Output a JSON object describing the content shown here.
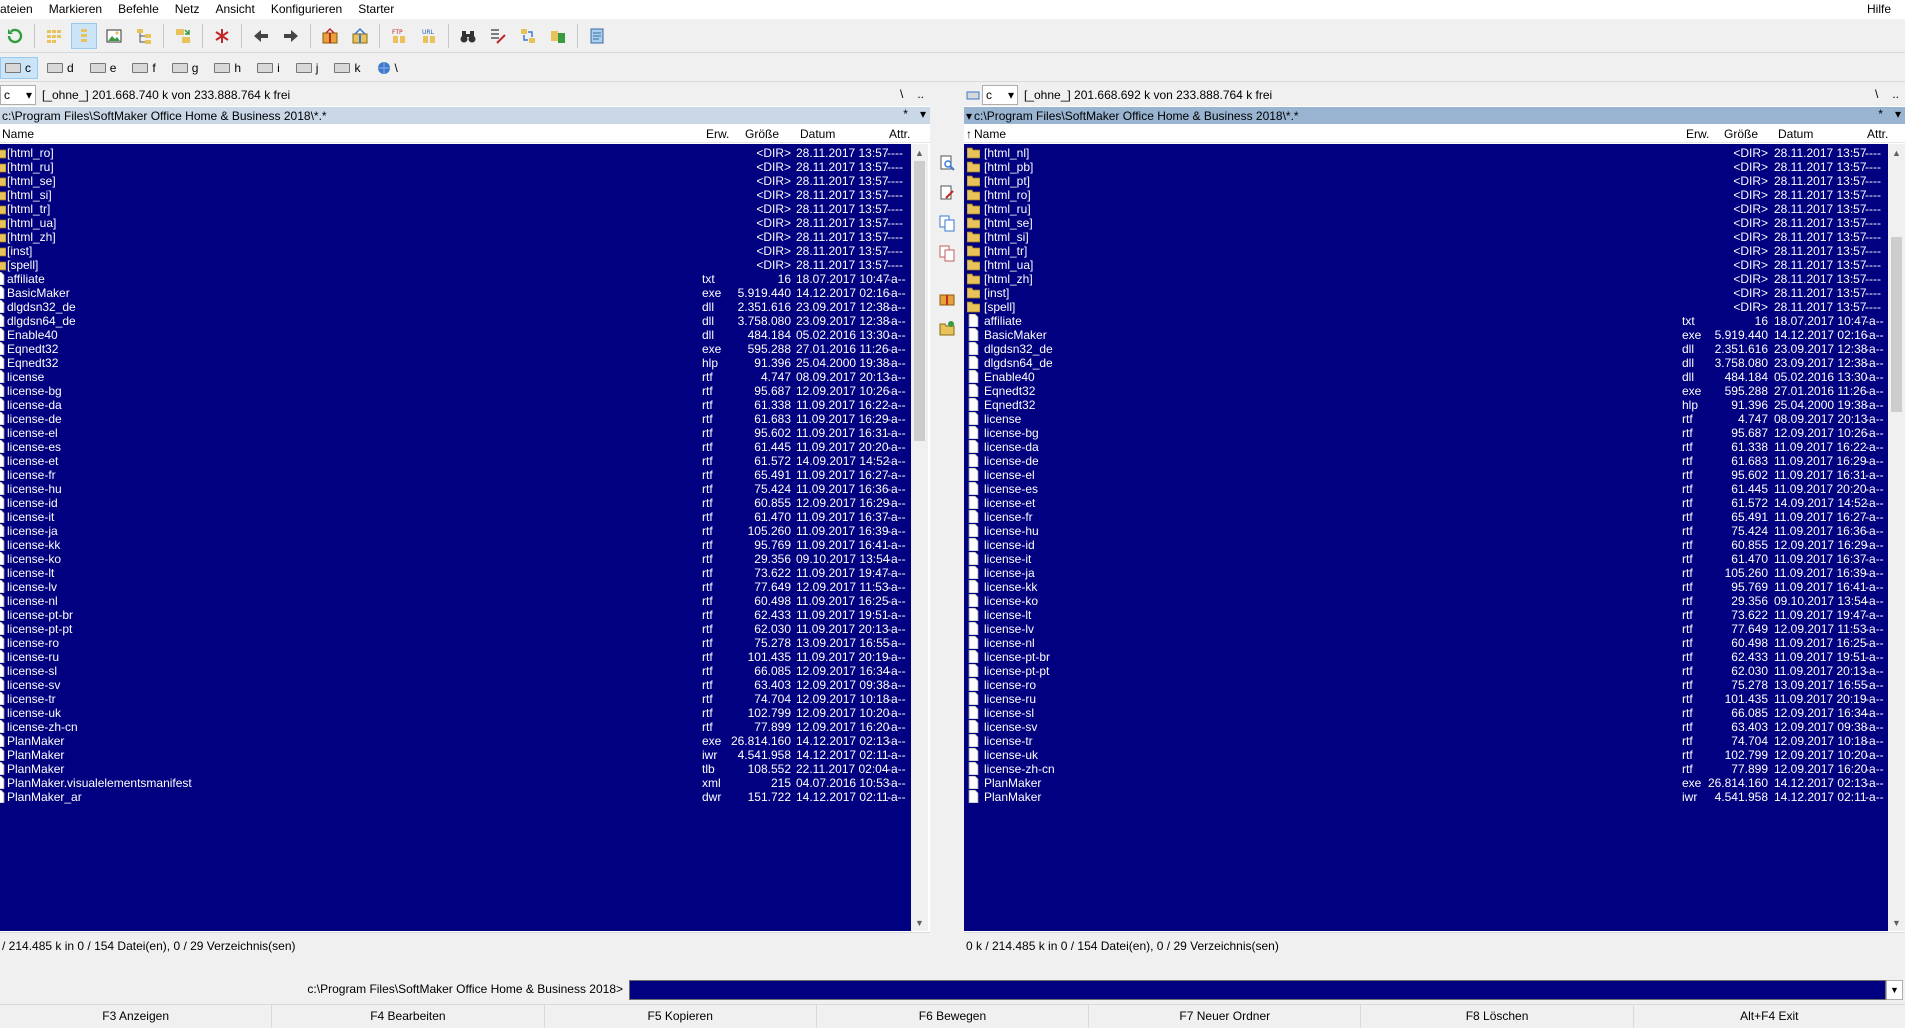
{
  "menu": [
    "ateien",
    "Markieren",
    "Befehle",
    "Netz",
    "Ansicht",
    "Konfigurieren",
    "Starter"
  ],
  "help": "Hilfe",
  "drives": [
    "c",
    "d",
    "e",
    "f",
    "g",
    "h",
    "i",
    "j",
    "k",
    "\\"
  ],
  "left": {
    "drive_select": "c",
    "free_info": "[_ohne_]  201.668.740 k von 233.888.764 k frei",
    "root_btn": "\\",
    "up_btn": "..",
    "path": "c:\\Program Files\\SoftMaker Office Home & Business 2018\\*.*",
    "star_btn": "*",
    "columns": {
      "name": "Name",
      "ext": "Erw.",
      "size": "Größe",
      "date": "Datum",
      "attr": "Attr."
    },
    "files": [
      [
        "[html_ro]",
        "",
        "<DIR>",
        "28.11.2017 13:57",
        "----"
      ],
      [
        "[html_ru]",
        "",
        "<DIR>",
        "28.11.2017 13:57",
        "----"
      ],
      [
        "[html_se]",
        "",
        "<DIR>",
        "28.11.2017 13:57",
        "----"
      ],
      [
        "[html_si]",
        "",
        "<DIR>",
        "28.11.2017 13:57",
        "----"
      ],
      [
        "[html_tr]",
        "",
        "<DIR>",
        "28.11.2017 13:57",
        "----"
      ],
      [
        "[html_ua]",
        "",
        "<DIR>",
        "28.11.2017 13:57",
        "----"
      ],
      [
        "[html_zh]",
        "",
        "<DIR>",
        "28.11.2017 13:57",
        "----"
      ],
      [
        "[inst]",
        "",
        "<DIR>",
        "28.11.2017 13:57",
        "----"
      ],
      [
        "[spell]",
        "",
        "<DIR>",
        "28.11.2017 13:57",
        "----"
      ],
      [
        "affiliate",
        "txt",
        "16",
        "18.07.2017 10:47",
        "-a--"
      ],
      [
        "BasicMaker",
        "exe",
        "5.919.440",
        "14.12.2017 02:16",
        "-a--"
      ],
      [
        "dlgdsn32_de",
        "dll",
        "2.351.616",
        "23.09.2017 12:38",
        "-a--"
      ],
      [
        "dlgdsn64_de",
        "dll",
        "3.758.080",
        "23.09.2017 12:38",
        "-a--"
      ],
      [
        "Enable40",
        "dll",
        "484.184",
        "05.02.2016 13:30",
        "-a--"
      ],
      [
        "Eqnedt32",
        "exe",
        "595.288",
        "27.01.2016 11:26",
        "-a--"
      ],
      [
        "Eqnedt32",
        "hlp",
        "91.396",
        "25.04.2000 19:38",
        "-a--"
      ],
      [
        "license",
        "rtf",
        "4.747",
        "08.09.2017 20:13",
        "-a--"
      ],
      [
        "license-bg",
        "rtf",
        "95.687",
        "12.09.2017 10:26",
        "-a--"
      ],
      [
        "license-da",
        "rtf",
        "61.338",
        "11.09.2017 16:22",
        "-a--"
      ],
      [
        "license-de",
        "rtf",
        "61.683",
        "11.09.2017 16:29",
        "-a--"
      ],
      [
        "license-el",
        "rtf",
        "95.602",
        "11.09.2017 16:31",
        "-a--"
      ],
      [
        "license-es",
        "rtf",
        "61.445",
        "11.09.2017 20:20",
        "-a--"
      ],
      [
        "license-et",
        "rtf",
        "61.572",
        "14.09.2017 14:52",
        "-a--"
      ],
      [
        "license-fr",
        "rtf",
        "65.491",
        "11.09.2017 16:27",
        "-a--"
      ],
      [
        "license-hu",
        "rtf",
        "75.424",
        "11.09.2017 16:36",
        "-a--"
      ],
      [
        "license-id",
        "rtf",
        "60.855",
        "12.09.2017 16:29",
        "-a--"
      ],
      [
        "license-it",
        "rtf",
        "61.470",
        "11.09.2017 16:37",
        "-a--"
      ],
      [
        "license-ja",
        "rtf",
        "105.260",
        "11.09.2017 16:39",
        "-a--"
      ],
      [
        "license-kk",
        "rtf",
        "95.769",
        "11.09.2017 16:41",
        "-a--"
      ],
      [
        "license-ko",
        "rtf",
        "29.356",
        "09.10.2017 13:54",
        "-a--"
      ],
      [
        "license-lt",
        "rtf",
        "73.622",
        "11.09.2017 19:47",
        "-a--"
      ],
      [
        "license-lv",
        "rtf",
        "77.649",
        "12.09.2017 11:53",
        "-a--"
      ],
      [
        "license-nl",
        "rtf",
        "60.498",
        "11.09.2017 16:25",
        "-a--"
      ],
      [
        "license-pt-br",
        "rtf",
        "62.433",
        "11.09.2017 19:51",
        "-a--"
      ],
      [
        "license-pt-pt",
        "rtf",
        "62.030",
        "11.09.2017 20:13",
        "-a--"
      ],
      [
        "license-ro",
        "rtf",
        "75.278",
        "13.09.2017 16:55",
        "-a--"
      ],
      [
        "license-ru",
        "rtf",
        "101.435",
        "11.09.2017 20:19",
        "-a--"
      ],
      [
        "license-sl",
        "rtf",
        "66.085",
        "12.09.2017 16:34",
        "-a--"
      ],
      [
        "license-sv",
        "rtf",
        "63.403",
        "12.09.2017 09:38",
        "-a--"
      ],
      [
        "license-tr",
        "rtf",
        "74.704",
        "12.09.2017 10:18",
        "-a--"
      ],
      [
        "license-uk",
        "rtf",
        "102.799",
        "12.09.2017 10:20",
        "-a--"
      ],
      [
        "license-zh-cn",
        "rtf",
        "77.899",
        "12.09.2017 16:20",
        "-a--"
      ],
      [
        "PlanMaker",
        "exe",
        "26.814.160",
        "14.12.2017 02:13",
        "-a--"
      ],
      [
        "PlanMaker",
        "iwr",
        "4.541.958",
        "14.12.2017 02:11",
        "-a--"
      ],
      [
        "PlanMaker",
        "tlb",
        "108.552",
        "22.11.2017 02:04",
        "-a--"
      ],
      [
        "PlanMaker.visualelementsmanifest",
        "xml",
        "215",
        "04.07.2016 10:53",
        "-a--"
      ],
      [
        "PlanMaker_ar",
        "dwr",
        "151.722",
        "14.12.2017 02:11",
        "-a--"
      ]
    ],
    "status": "/ 214.485 k in 0 / 154 Datei(en), 0 / 29 Verzeichnis(sen)"
  },
  "right": {
    "drive_select": "c",
    "free_info": "[_ohne_]  201.668.692 k von 233.888.764 k frei",
    "root_btn": "\\",
    "up_btn": "..",
    "path": "c:\\Program Files\\SoftMaker Office Home & Business 2018\\*.*",
    "star_btn": "*",
    "columns": {
      "name": "Name",
      "ext": "Erw.",
      "size": "Größe",
      "date": "Datum",
      "attr": "Attr."
    },
    "files": [
      [
        "[html_nl]",
        "",
        "<DIR>",
        "28.11.2017 13:57",
        "----"
      ],
      [
        "[html_pb]",
        "",
        "<DIR>",
        "28.11.2017 13:57",
        "----"
      ],
      [
        "[html_pt]",
        "",
        "<DIR>",
        "28.11.2017 13:57",
        "----"
      ],
      [
        "[html_ro]",
        "",
        "<DIR>",
        "28.11.2017 13:57",
        "----"
      ],
      [
        "[html_ru]",
        "",
        "<DIR>",
        "28.11.2017 13:57",
        "----"
      ],
      [
        "[html_se]",
        "",
        "<DIR>",
        "28.11.2017 13:57",
        "----"
      ],
      [
        "[html_si]",
        "",
        "<DIR>",
        "28.11.2017 13:57",
        "----"
      ],
      [
        "[html_tr]",
        "",
        "<DIR>",
        "28.11.2017 13:57",
        "----"
      ],
      [
        "[html_ua]",
        "",
        "<DIR>",
        "28.11.2017 13:57",
        "----"
      ],
      [
        "[html_zh]",
        "",
        "<DIR>",
        "28.11.2017 13:57",
        "----"
      ],
      [
        "[inst]",
        "",
        "<DIR>",
        "28.11.2017 13:57",
        "----"
      ],
      [
        "[spell]",
        "",
        "<DIR>",
        "28.11.2017 13:57",
        "----"
      ],
      [
        "affiliate",
        "txt",
        "16",
        "18.07.2017 10:47",
        "-a--"
      ],
      [
        "BasicMaker",
        "exe",
        "5.919.440",
        "14.12.2017 02:16",
        "-a--"
      ],
      [
        "dlgdsn32_de",
        "dll",
        "2.351.616",
        "23.09.2017 12:38",
        "-a--"
      ],
      [
        "dlgdsn64_de",
        "dll",
        "3.758.080",
        "23.09.2017 12:38",
        "-a--"
      ],
      [
        "Enable40",
        "dll",
        "484.184",
        "05.02.2016 13:30",
        "-a--"
      ],
      [
        "Eqnedt32",
        "exe",
        "595.288",
        "27.01.2016 11:26",
        "-a--"
      ],
      [
        "Eqnedt32",
        "hlp",
        "91.396",
        "25.04.2000 19:38",
        "-a--"
      ],
      [
        "license",
        "rtf",
        "4.747",
        "08.09.2017 20:13",
        "-a--"
      ],
      [
        "license-bg",
        "rtf",
        "95.687",
        "12.09.2017 10:26",
        "-a--"
      ],
      [
        "license-da",
        "rtf",
        "61.338",
        "11.09.2017 16:22",
        "-a--"
      ],
      [
        "license-de",
        "rtf",
        "61.683",
        "11.09.2017 16:29",
        "-a--"
      ],
      [
        "license-el",
        "rtf",
        "95.602",
        "11.09.2017 16:31",
        "-a--"
      ],
      [
        "license-es",
        "rtf",
        "61.445",
        "11.09.2017 20:20",
        "-a--"
      ],
      [
        "license-et",
        "rtf",
        "61.572",
        "14.09.2017 14:52",
        "-a--"
      ],
      [
        "license-fr",
        "rtf",
        "65.491",
        "11.09.2017 16:27",
        "-a--"
      ],
      [
        "license-hu",
        "rtf",
        "75.424",
        "11.09.2017 16:36",
        "-a--"
      ],
      [
        "license-id",
        "rtf",
        "60.855",
        "12.09.2017 16:29",
        "-a--"
      ],
      [
        "license-it",
        "rtf",
        "61.470",
        "11.09.2017 16:37",
        "-a--"
      ],
      [
        "license-ja",
        "rtf",
        "105.260",
        "11.09.2017 16:39",
        "-a--"
      ],
      [
        "license-kk",
        "rtf",
        "95.769",
        "11.09.2017 16:41",
        "-a--"
      ],
      [
        "license-ko",
        "rtf",
        "29.356",
        "09.10.2017 13:54",
        "-a--"
      ],
      [
        "license-lt",
        "rtf",
        "73.622",
        "11.09.2017 19:47",
        "-a--"
      ],
      [
        "license-lv",
        "rtf",
        "77.649",
        "12.09.2017 11:53",
        "-a--"
      ],
      [
        "license-nl",
        "rtf",
        "60.498",
        "11.09.2017 16:25",
        "-a--"
      ],
      [
        "license-pt-br",
        "rtf",
        "62.433",
        "11.09.2017 19:51",
        "-a--"
      ],
      [
        "license-pt-pt",
        "rtf",
        "62.030",
        "11.09.2017 20:13",
        "-a--"
      ],
      [
        "license-ro",
        "rtf",
        "75.278",
        "13.09.2017 16:55",
        "-a--"
      ],
      [
        "license-ru",
        "rtf",
        "101.435",
        "11.09.2017 20:19",
        "-a--"
      ],
      [
        "license-sl",
        "rtf",
        "66.085",
        "12.09.2017 16:34",
        "-a--"
      ],
      [
        "license-sv",
        "rtf",
        "63.403",
        "12.09.2017 09:38",
        "-a--"
      ],
      [
        "license-tr",
        "rtf",
        "74.704",
        "12.09.2017 10:18",
        "-a--"
      ],
      [
        "license-uk",
        "rtf",
        "102.799",
        "12.09.2017 10:20",
        "-a--"
      ],
      [
        "license-zh-cn",
        "rtf",
        "77.899",
        "12.09.2017 16:20",
        "-a--"
      ],
      [
        "PlanMaker",
        "exe",
        "26.814.160",
        "14.12.2017 02:13",
        "-a--"
      ],
      [
        "PlanMaker",
        "iwr",
        "4.541.958",
        "14.12.2017 02:11",
        "-a--"
      ]
    ],
    "status": "0 k / 214.485 k in 0 / 154 Datei(en), 0 / 29 Verzeichnis(sen)"
  },
  "command_line": {
    "path": "c:\\Program Files\\SoftMaker Office Home & Business 2018>",
    "value": ""
  },
  "function_keys": [
    "F3 Anzeigen",
    "F4 Bearbeiten",
    "F5 Kopieren",
    "F6 Bewegen",
    "F7 Neuer Ordner",
    "F8 Löschen",
    "Alt+F4 Exit"
  ],
  "colors": {
    "selection": "#000080",
    "pathbar": "#c9d7e6",
    "folder": "#e8c25a"
  }
}
